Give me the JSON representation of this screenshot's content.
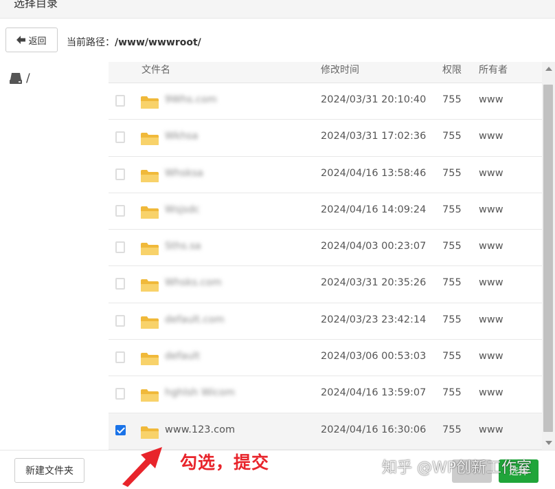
{
  "window": {
    "title": "选择目录"
  },
  "pathbar": {
    "back_label": "返回",
    "path_prefix": "当前路径：",
    "path_value": "/www/wwwroot/"
  },
  "tree": {
    "root_label": "/"
  },
  "table": {
    "headers": {
      "name": "文件名",
      "modified": "修改时间",
      "perm": "权限",
      "owner": "所有者"
    },
    "rows": [
      {
        "name": "9Whs.com",
        "time": "2024/03/31 20:10:40",
        "perm": "755",
        "owner": "www",
        "checked": false,
        "blurred": true
      },
      {
        "name": "Wkhsa",
        "time": "2024/03/31 17:02:36",
        "perm": "755",
        "owner": "www",
        "checked": false,
        "blurred": true
      },
      {
        "name": "Whsksa",
        "time": "2024/04/16 13:58:46",
        "perm": "755",
        "owner": "www",
        "checked": false,
        "blurred": true
      },
      {
        "name": "Wsjsdc",
        "time": "2024/04/16 14:09:24",
        "perm": "755",
        "owner": "www",
        "checked": false,
        "blurred": true
      },
      {
        "name": "Sths.sa",
        "time": "2024/04/03 00:23:07",
        "perm": "755",
        "owner": "www",
        "checked": false,
        "blurred": true
      },
      {
        "name": "Whsks.com",
        "time": "2024/03/31 20:35:26",
        "perm": "755",
        "owner": "www",
        "checked": false,
        "blurred": true
      },
      {
        "name": "default.com",
        "time": "2024/03/23 23:42:14",
        "perm": "755",
        "owner": "www",
        "checked": false,
        "blurred": true
      },
      {
        "name": "default",
        "time": "2024/03/06 00:53:03",
        "perm": "755",
        "owner": "www",
        "checked": false,
        "blurred": true
      },
      {
        "name": "hghlsh Wicom",
        "time": "2024/04/16 13:59:07",
        "perm": "755",
        "owner": "www",
        "checked": false,
        "blurred": true
      },
      {
        "name": "www.123.com",
        "time": "2024/04/16 16:30:06",
        "perm": "755",
        "owner": "www",
        "checked": true,
        "blurred": false
      }
    ]
  },
  "footer": {
    "new_folder_label": "新建文件夹",
    "confirm_label": "选择"
  },
  "annotation": {
    "text": "勾选，提交",
    "color": "#e8242b"
  },
  "watermark": {
    "text": "知乎 @WP创新工作室"
  },
  "colors": {
    "checkbox": "#1a73e8",
    "confirm": "#20a53a",
    "folder": "#f6c54a"
  }
}
